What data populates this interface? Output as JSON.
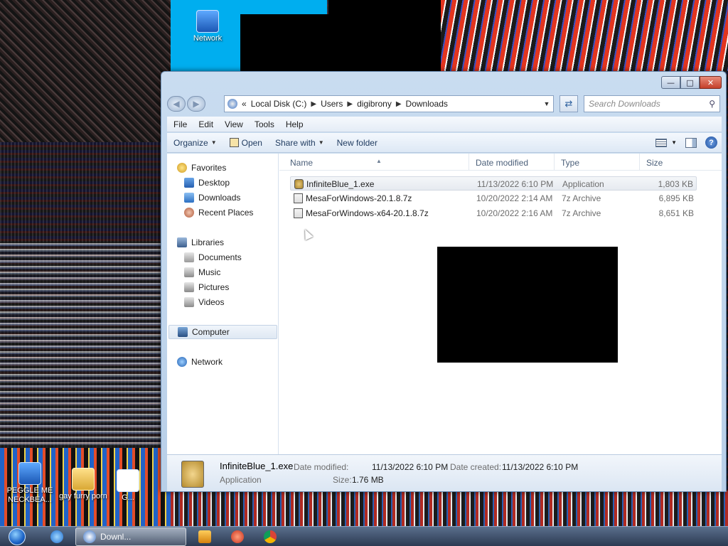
{
  "desktop": {
    "icons": [
      {
        "label": "Network",
        "icon": "network-icon"
      },
      {
        "label": "PEGGLE ME NECKBEA...",
        "icon": "shortcut-icon"
      },
      {
        "label": "gay furry porn",
        "icon": "folder-icon"
      },
      {
        "label": "G...",
        "icon": "shortcut-icon"
      }
    ]
  },
  "window": {
    "address": {
      "crumbs": [
        "Local Disk (C:)",
        "Users",
        "digibrony",
        "Downloads"
      ],
      "overflow": "«"
    },
    "search": {
      "placeholder": "Search Downloads"
    },
    "menu": [
      "File",
      "Edit",
      "View",
      "Tools",
      "Help"
    ],
    "toolbar": {
      "organize": "Organize",
      "open": "Open",
      "share_with": "Share with",
      "new_folder": "New folder"
    },
    "nav": {
      "favorites": "Favorites",
      "desktop": "Desktop",
      "downloads": "Downloads",
      "recent_places": "Recent Places",
      "libraries": "Libraries",
      "documents": "Documents",
      "music": "Music",
      "pictures": "Pictures",
      "videos": "Videos",
      "computer": "Computer",
      "network": "Network"
    },
    "columns": {
      "name": "Name",
      "date_modified": "Date modified",
      "type": "Type",
      "size": "Size"
    },
    "files": [
      {
        "name": "InfiniteBlue_1.exe",
        "date": "11/13/2022 6:10 PM",
        "type": "Application",
        "size": "1,803 KB"
      },
      {
        "name": "MesaForWindows-20.1.8.7z",
        "date": "10/20/2022 2:14 AM",
        "type": "7z Archive",
        "size": "6,895 KB"
      },
      {
        "name": "MesaForWindows-x64-20.1.8.7z",
        "date": "10/20/2022 2:16 AM",
        "type": "7z Archive",
        "size": "8,651 KB"
      }
    ],
    "details": {
      "name": "InfiniteBlue_1.exe",
      "type": "Application",
      "modified_label": "Date modified:",
      "modified": "11/13/2022 6:10 PM",
      "created_label": "Date created:",
      "created": "11/13/2022 6:10 PM",
      "size_label": "Size:",
      "size": "1.76 MB"
    }
  },
  "taskbar": {
    "active_label": "Downl...",
    "pinned": [
      "internet-explorer-icon",
      "explorer-icon",
      "media-player-icon",
      "app-icon",
      "chrome-icon"
    ]
  }
}
